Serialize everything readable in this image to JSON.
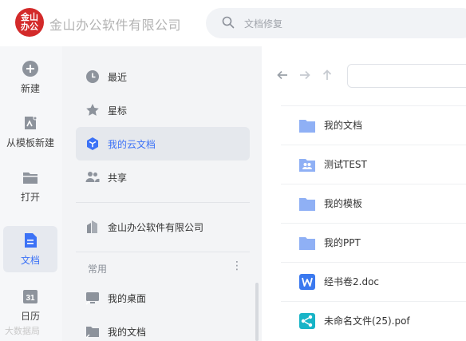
{
  "header": {
    "logo_line1": "金山",
    "logo_line2": "办公",
    "brand": "金山办公软件有限公司",
    "search_placeholder": "文档修复"
  },
  "rail": [
    {
      "label": "新建",
      "icon": "plus-circle-icon"
    },
    {
      "label": "从模板新建",
      "icon": "template-icon"
    },
    {
      "label": "打开",
      "icon": "folder-icon"
    },
    {
      "label": "文档",
      "icon": "document-icon",
      "active": true
    },
    {
      "label": "日历",
      "icon": "calendar-icon",
      "icon_text": "31"
    }
  ],
  "nav": {
    "items": [
      {
        "label": "最近",
        "icon": "clock-icon"
      },
      {
        "label": "星标",
        "icon": "star-icon"
      },
      {
        "label": "我的云文档",
        "icon": "cloud-cube-icon",
        "active": true
      },
      {
        "label": "共享",
        "icon": "people-icon"
      }
    ],
    "company": {
      "label": "金山办公软件有限公司",
      "icon": "building-icon"
    },
    "section_title": "常用",
    "section_more": "⋮",
    "common": [
      {
        "label": "我的桌面",
        "icon": "desktop-shortcut-icon"
      },
      {
        "label": "我的文档",
        "icon": "folder-shortcut-icon"
      }
    ]
  },
  "files": [
    {
      "name": "我的文档",
      "icon": "folder-icon"
    },
    {
      "name": "测试TEST",
      "icon": "shared-folder-icon"
    },
    {
      "name": "我的模板",
      "icon": "folder-icon"
    },
    {
      "name": "我的PPT",
      "icon": "folder-icon"
    },
    {
      "name": "经书卷2.doc",
      "icon": "word-doc-icon"
    },
    {
      "name": "未命名文件(25).pof",
      "icon": "mindmap-file-icon"
    }
  ],
  "watermark": "大数据局",
  "colors": {
    "brand_red": "#d32a2a",
    "accent_blue": "#3c72f6",
    "folder_blue": "#8fb0f5",
    "word_blue": "#3b79ef",
    "mindmap_teal": "#18b4c7"
  }
}
